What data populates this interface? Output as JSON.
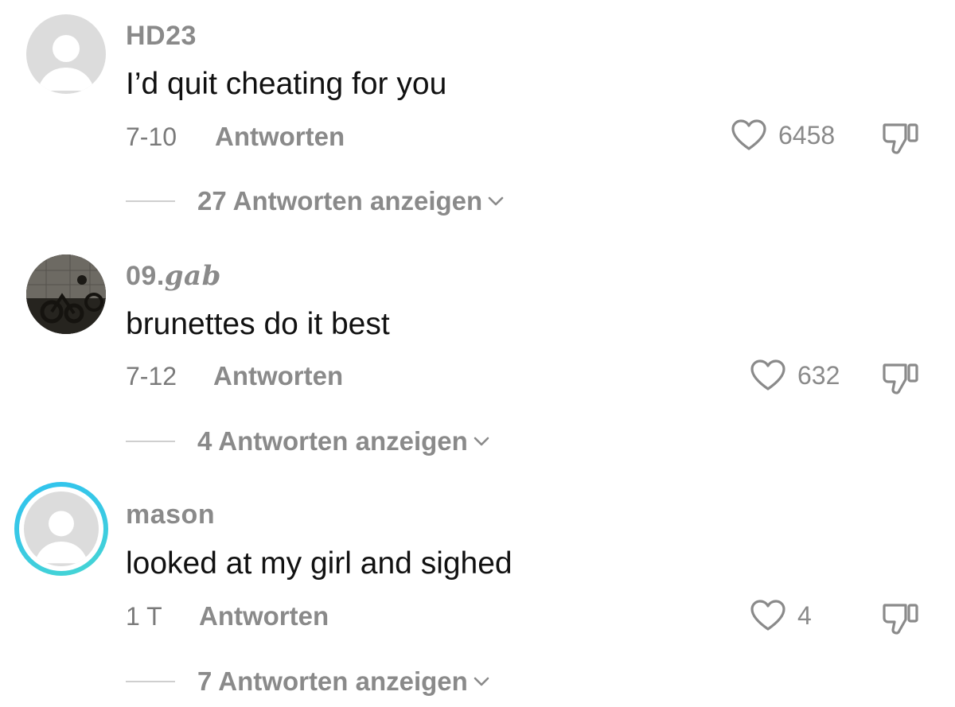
{
  "comments": [
    {
      "username": "HD23",
      "text": "I’d quit cheating for you",
      "date": "7-10",
      "reply_label": "Antworten",
      "likes": "6458",
      "view_replies": "27 Antworten anzeigen",
      "avatar": "default-avatar"
    },
    {
      "username_prefix": "09.",
      "username_suffix": "gab",
      "text": "brunettes do it best",
      "date": "7-12",
      "reply_label": "Antworten",
      "likes": "632",
      "view_replies": "4 Antworten anzeigen",
      "avatar": "photo-avatar"
    },
    {
      "username": "mason",
      "text": "looked at my girl and sighed",
      "date": "1 T",
      "reply_label": "Antworten",
      "likes": "4",
      "view_replies": "7 Antworten anzeigen",
      "avatar": "default-avatar-story-ring"
    }
  ],
  "colors": {
    "story_ring": "#2fc3ee",
    "muted_text": "#8a8a8a",
    "primary_text": "#111111"
  }
}
